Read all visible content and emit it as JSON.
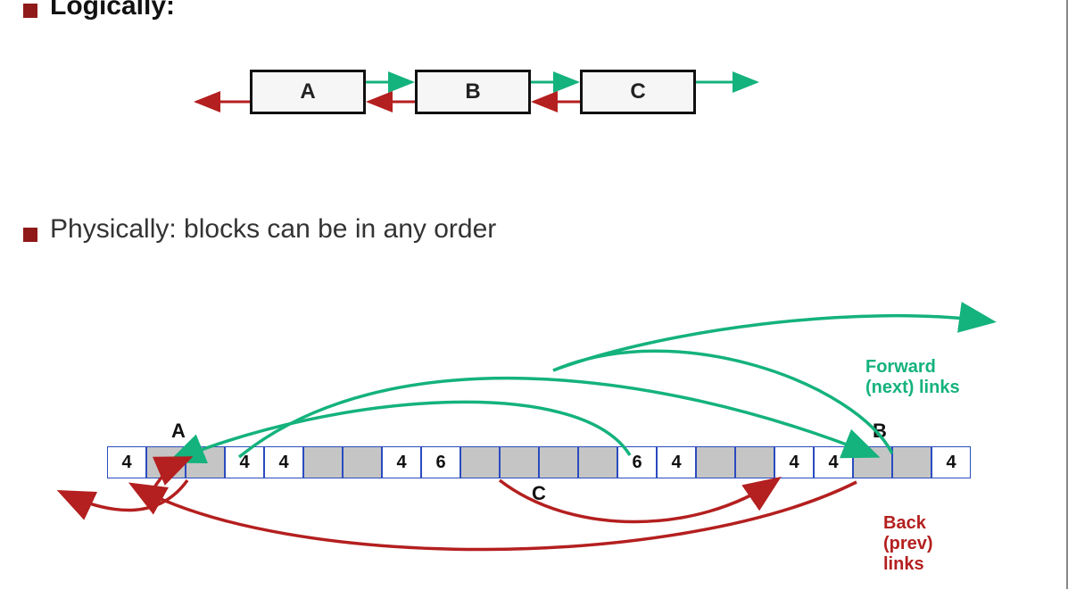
{
  "bullets": {
    "logically": "Logically:",
    "physically": "Physically: blocks can be in any order"
  },
  "logical": {
    "boxes": [
      "A",
      "B",
      "C"
    ]
  },
  "physical": {
    "labels": {
      "A": "A",
      "B": "B",
      "C": "C"
    },
    "cells": [
      {
        "v": "4",
        "shade": false
      },
      {
        "v": "",
        "shade": true
      },
      {
        "v": "",
        "shade": true
      },
      {
        "v": "4",
        "shade": false
      },
      {
        "v": "4",
        "shade": false
      },
      {
        "v": "",
        "shade": true
      },
      {
        "v": "",
        "shade": true
      },
      {
        "v": "4",
        "shade": false
      },
      {
        "v": "6",
        "shade": false
      },
      {
        "v": "",
        "shade": true
      },
      {
        "v": "",
        "shade": true
      },
      {
        "v": "",
        "shade": true
      },
      {
        "v": "",
        "shade": true
      },
      {
        "v": "6",
        "shade": false
      },
      {
        "v": "4",
        "shade": false
      },
      {
        "v": "",
        "shade": true
      },
      {
        "v": "",
        "shade": true
      },
      {
        "v": "4",
        "shade": false
      },
      {
        "v": "4",
        "shade": false
      },
      {
        "v": "",
        "shade": true
      },
      {
        "v": "",
        "shade": true
      },
      {
        "v": "4",
        "shade": false
      }
    ],
    "legend_forward": "Forward (next) links",
    "legend_back": "Back (prev) links"
  },
  "colors": {
    "forward": "#14b27c",
    "back": "#b41f1f"
  }
}
